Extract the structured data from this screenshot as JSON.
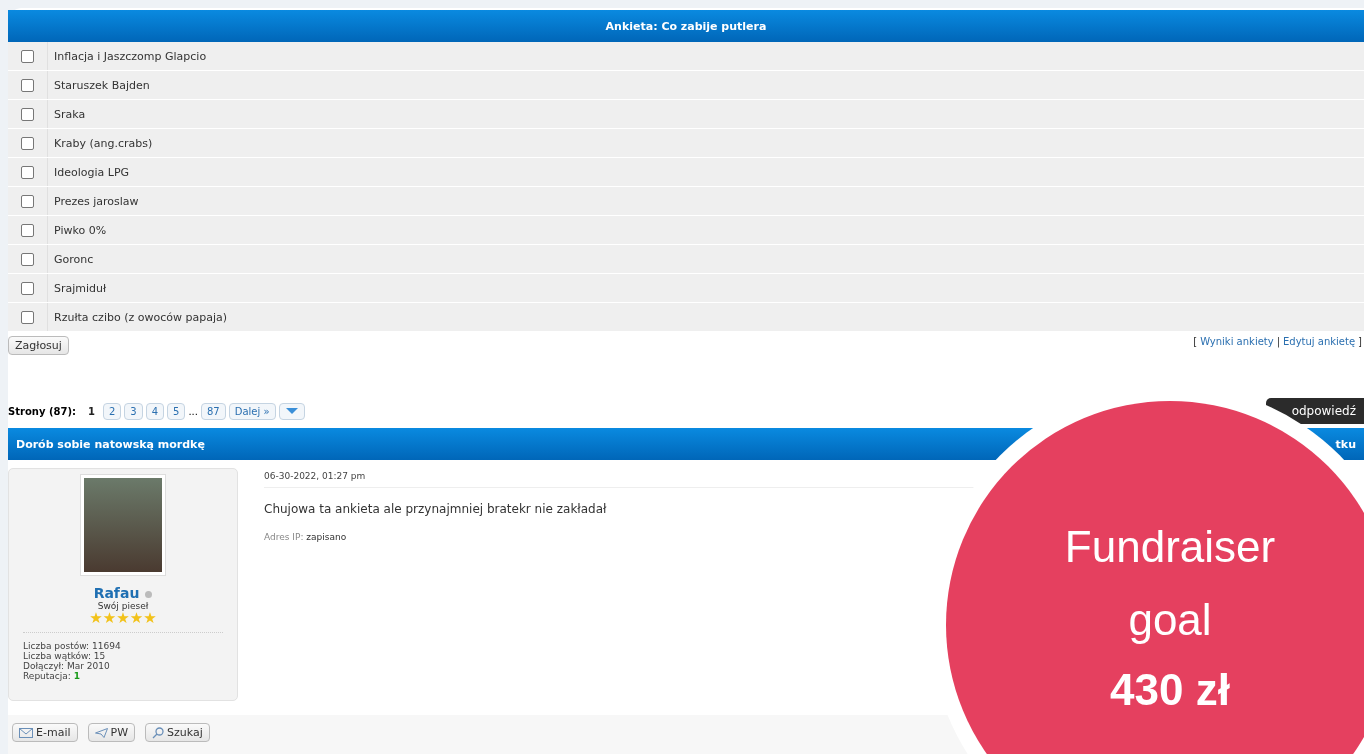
{
  "poll": {
    "title": "Ankieta: Co zabije putlera",
    "options": [
      {
        "label": "Inflacja i Jaszczomp Glapcio",
        "checked": false
      },
      {
        "label": "Staruszek Bajden",
        "checked": false
      },
      {
        "label": "Sraka",
        "checked": false
      },
      {
        "label": "Kraby (ang.crabs)",
        "checked": false
      },
      {
        "label": "Ideologia LPG",
        "checked": false
      },
      {
        "label": "Prezes jaroslaw",
        "checked": false
      },
      {
        "label": "Piwko 0%",
        "checked": false
      },
      {
        "label": "Goronc",
        "checked": false
      },
      {
        "label": "Srajmiduł",
        "checked": false
      },
      {
        "label": "Rzułta czibo (z owoców papaja)",
        "checked": false
      }
    ],
    "vote_button": "Zagłosuj",
    "links_open": "[",
    "links": [
      "Wyniki ankiety",
      "Edytuj ankietę"
    ],
    "links_sep": "|",
    "links_close": "]"
  },
  "pagination": {
    "label": "Strony (87):",
    "pages": [
      {
        "label": "1",
        "selected": true
      },
      {
        "label": "2",
        "selected": false
      },
      {
        "label": "3",
        "selected": false
      },
      {
        "label": "4",
        "selected": false
      },
      {
        "label": "5",
        "selected": false
      }
    ],
    "ellipsis": "...",
    "last": "87",
    "next": "Dalej »"
  },
  "reply_button": "odpowiedź",
  "thread": {
    "title": "Dorób sobie natowską mordkę",
    "title_right": "tku"
  },
  "post": {
    "author": {
      "name": "Rafau",
      "online": false,
      "rank": "Swój pieseł",
      "stars": 5,
      "stats": [
        {
          "label": "Liczba postów:",
          "value": "11694"
        },
        {
          "label": "Liczba wątków:",
          "value": "15"
        },
        {
          "label": "Dołączył:",
          "value": "Mar 2010"
        },
        {
          "label": "Reputacja:",
          "value": "1",
          "kind": "reputation"
        }
      ]
    },
    "date": "06-30-2022, 01:27 pm",
    "message": "Chujowa ta ankieta ale przynajmniej bratekr nie zakładał",
    "ip_label": "Adres IP:",
    "ip_value": "zapisano",
    "buttons": [
      {
        "label": "E-mail",
        "kind": "email"
      },
      {
        "label": "PW",
        "kind": "pm"
      },
      {
        "label": "Szukaj",
        "kind": "search"
      }
    ]
  },
  "fundraiser": {
    "line1": "Fundraiser",
    "line2": "goal",
    "amount": "430 zł"
  }
}
